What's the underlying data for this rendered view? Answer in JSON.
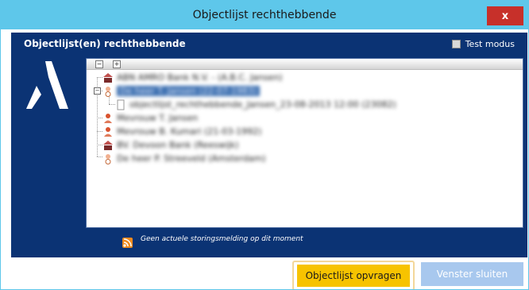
{
  "window": {
    "title": "Objectlijst rechthebbende",
    "close_label": "x"
  },
  "header": {
    "label": "Objectlijst(en) rechthebbende",
    "test_mode_label": "Test modus",
    "test_mode_checked": false
  },
  "tree": {
    "toolbar": {
      "collapse_label": "−",
      "expand_label": "+"
    },
    "items": [
      {
        "label": "ABN AMRO Bank N.V. - (A.B.C. Jansen)",
        "icon": "bank-icon",
        "level": 0,
        "selected": false
      },
      {
        "label": "De heer T. Jansen (22-07-1983)",
        "icon": "person-male-icon",
        "level": 0,
        "selected": true,
        "expanded": true
      },
      {
        "label": "objectlijst_rechthebbende_Jansen_23-08-2013 12:00 (23082)",
        "icon": "document-icon",
        "level": 1,
        "selected": false
      },
      {
        "label": "Mevrouw T. Jansen",
        "icon": "person-female-icon",
        "level": 0,
        "selected": false
      },
      {
        "label": "Mevrouw B. Kumari (21-03-1992)",
        "icon": "person-female-icon",
        "level": 0,
        "selected": false
      },
      {
        "label": "BV. Devoon Bank (Reeswijk)",
        "icon": "bank-icon",
        "level": 0,
        "selected": false
      },
      {
        "label": "De heer P. Streeveld (Amsterdam)",
        "icon": "person-male-icon",
        "level": 0,
        "selected": false
      }
    ]
  },
  "status": {
    "message": "Geen actuele storingsmelding op dit moment",
    "icon": "rss-icon"
  },
  "footer": {
    "primary_label": "Objectlijst opvragen",
    "secondary_label": "Venster sluiten"
  },
  "colors": {
    "titlebar": "#5ec7ea",
    "panel": "#0b3374",
    "primary": "#f7c300",
    "secondary": "#a8c8ee",
    "close": "#c7302a"
  }
}
